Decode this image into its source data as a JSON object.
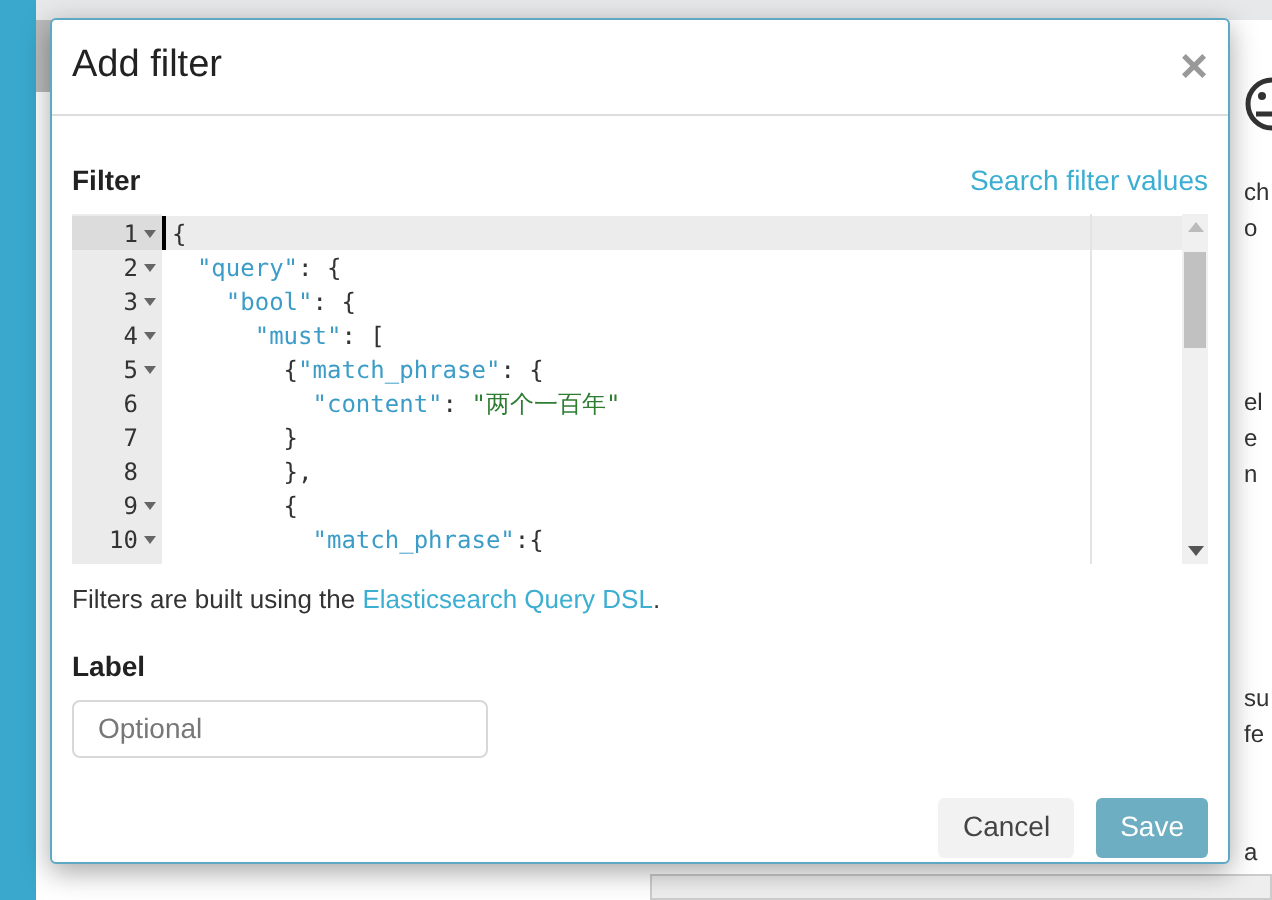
{
  "dialog": {
    "title": "Add filter",
    "close": "×"
  },
  "filter": {
    "label": "Filter",
    "link": "Search filter values",
    "editor": {
      "lines": [
        {
          "number": "1",
          "foldable": true,
          "active": true,
          "tokens": [
            {
              "kind": "punct",
              "text": "{"
            }
          ]
        },
        {
          "number": "2",
          "foldable": true,
          "active": false,
          "tokens": [
            {
              "kind": "key",
              "text": "  \"query\""
            },
            {
              "kind": "punct",
              "text": ": {"
            }
          ]
        },
        {
          "number": "3",
          "foldable": true,
          "active": false,
          "tokens": [
            {
              "kind": "key",
              "text": "    \"bool\""
            },
            {
              "kind": "punct",
              "text": ": {"
            }
          ]
        },
        {
          "number": "4",
          "foldable": true,
          "active": false,
          "tokens": [
            {
              "kind": "key",
              "text": "      \"must\""
            },
            {
              "kind": "punct",
              "text": ": ["
            }
          ]
        },
        {
          "number": "5",
          "foldable": true,
          "active": false,
          "tokens": [
            {
              "kind": "punct",
              "text": "        {"
            },
            {
              "kind": "key",
              "text": "\"match_phrase\""
            },
            {
              "kind": "punct",
              "text": ": {"
            }
          ]
        },
        {
          "number": "6",
          "foldable": false,
          "active": false,
          "tokens": [
            {
              "kind": "key",
              "text": "          \"content\""
            },
            {
              "kind": "punct",
              "text": ": "
            },
            {
              "kind": "string",
              "text": "\"两个一百年\""
            }
          ]
        },
        {
          "number": "7",
          "foldable": false,
          "active": false,
          "tokens": [
            {
              "kind": "punct",
              "text": "        }"
            }
          ]
        },
        {
          "number": "8",
          "foldable": false,
          "active": false,
          "tokens": [
            {
              "kind": "punct",
              "text": "        },"
            }
          ]
        },
        {
          "number": "9",
          "foldable": true,
          "active": false,
          "tokens": [
            {
              "kind": "punct",
              "text": "        {"
            }
          ]
        },
        {
          "number": "10",
          "foldable": true,
          "active": false,
          "tokens": [
            {
              "kind": "key",
              "text": "          \"match_phrase\""
            },
            {
              "kind": "punct",
              "text": ":{"
            }
          ]
        }
      ]
    },
    "help": {
      "before": "Filters are built using the ",
      "link": "Elasticsearch Query DSL",
      "after": "."
    }
  },
  "label": {
    "label": "Label",
    "placeholder": "Optional"
  },
  "buttons": [
    {
      "kind": "secondary",
      "label": "Cancel"
    },
    {
      "kind": "primary",
      "label": "Save"
    }
  ],
  "background_fragments": [
    "ch",
    "o",
    "el",
    "e",
    "n",
    "su",
    "fe",
    "a"
  ]
}
